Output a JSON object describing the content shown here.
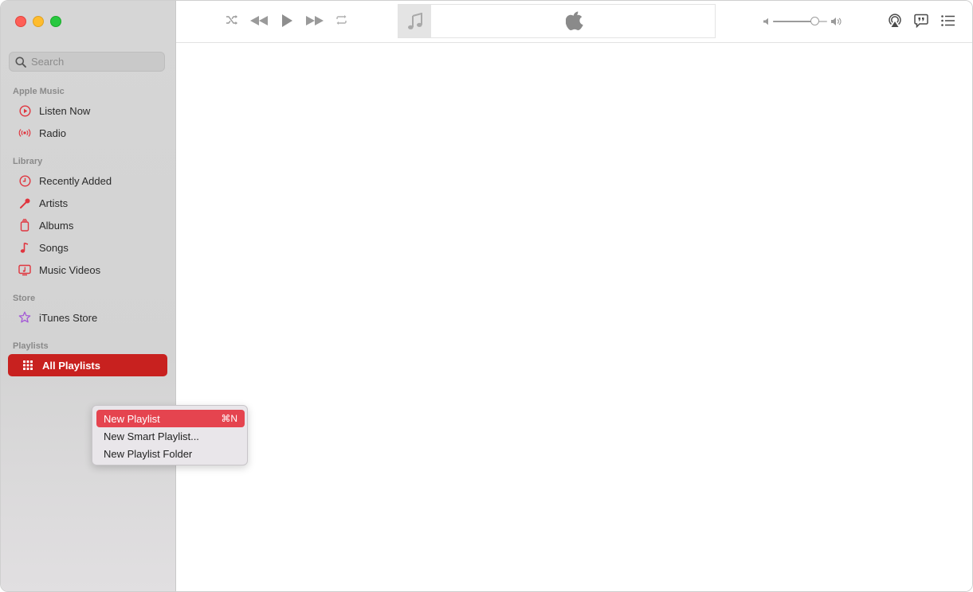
{
  "search": {
    "placeholder": "Search"
  },
  "sidebar": {
    "sections": [
      {
        "title": "Apple Music",
        "items": [
          {
            "label": "Listen Now"
          },
          {
            "label": "Radio"
          }
        ]
      },
      {
        "title": "Library",
        "items": [
          {
            "label": "Recently Added"
          },
          {
            "label": "Artists"
          },
          {
            "label": "Albums"
          },
          {
            "label": "Songs"
          },
          {
            "label": "Music Videos"
          }
        ]
      },
      {
        "title": "Store",
        "items": [
          {
            "label": "iTunes Store"
          }
        ]
      },
      {
        "title": "Playlists",
        "items": [
          {
            "label": "All Playlists"
          }
        ]
      }
    ]
  },
  "context_menu": {
    "items": [
      {
        "label": "New Playlist",
        "shortcut": "⌘N"
      },
      {
        "label": "New Smart Playlist..."
      },
      {
        "label": "New Playlist Folder"
      }
    ]
  },
  "volume": {
    "level": 0.82
  },
  "colors": {
    "accent": "#c8211f",
    "menu_highlight": "#e5444f",
    "icon_red": "#e0353e",
    "store_purple": "#a45ad6"
  },
  "icons": {
    "toolbar": [
      "shuffle-icon",
      "previous-icon",
      "play-icon",
      "next-icon",
      "repeat-icon",
      "music-note-icon",
      "apple-logo-icon",
      "volume-low-icon",
      "volume-high-icon",
      "airplay-icon",
      "lyrics-icon",
      "queue-list-icon"
    ],
    "sidebar": [
      "play-circle-icon",
      "radio-waves-icon",
      "clock-icon",
      "microphone-icon",
      "album-stack-icon",
      "music-note-icon",
      "music-video-icon",
      "star-icon",
      "grid-icon"
    ]
  }
}
